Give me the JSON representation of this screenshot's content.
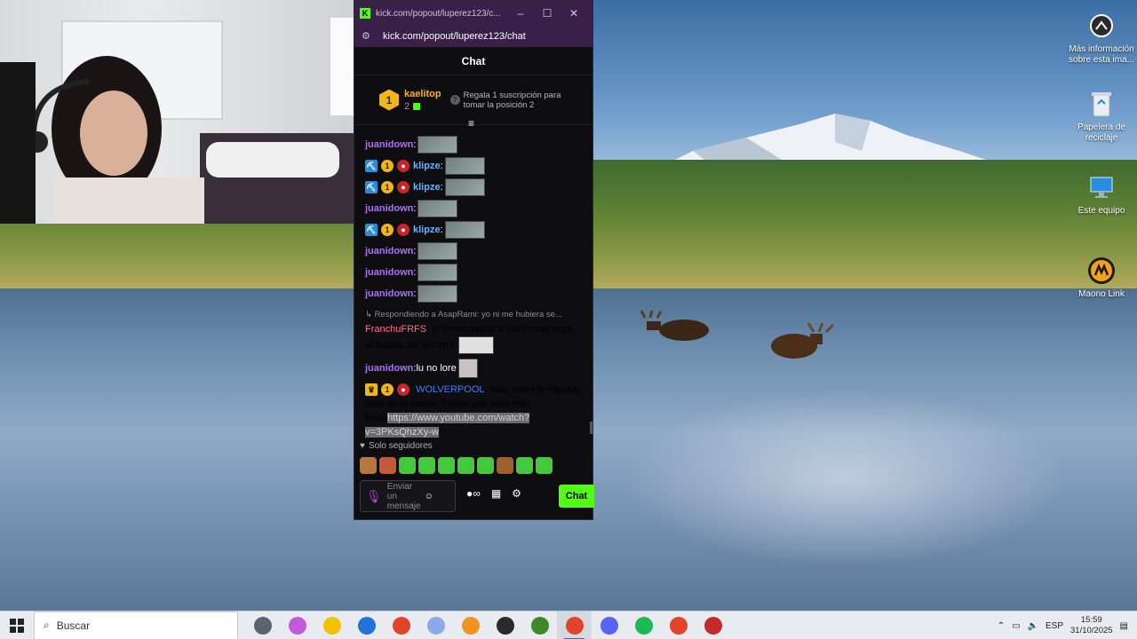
{
  "desktop": {
    "icons": [
      {
        "label": "Más información sobre esta ima...",
        "icon": "camera-info-icon"
      },
      {
        "label": "Papelera de reciclaje",
        "icon": "recycle-bin-icon"
      },
      {
        "label": "Este equipo",
        "icon": "monitor-icon"
      },
      {
        "label": "Maono Link",
        "icon": "maono-link-icon"
      }
    ]
  },
  "browser": {
    "title": "kick.com/popout/luperez123/c...",
    "url": "kick.com/popout/luperez123/chat",
    "controls": {
      "minimize": "–",
      "maximize": "☐",
      "close": "✕"
    }
  },
  "chat": {
    "header": "Chat",
    "leaderboard": {
      "rank": "1",
      "user": "kaelitop",
      "count": "2",
      "hint": "Regala 1 suscripción para tomar la posición 2",
      "hint_icon": "?"
    },
    "filter_icon": "≡",
    "messages": [
      {
        "user": "juanidown",
        "color": "#a970ff",
        "text": "",
        "badges": [],
        "emote": true
      },
      {
        "user": "klipze",
        "color": "#6fb2ff",
        "text": "",
        "badges": [
          "pick",
          "one",
          "red"
        ],
        "emote": true
      },
      {
        "user": "klipze",
        "color": "#6fb2ff",
        "text": "",
        "badges": [
          "pick",
          "one",
          "red"
        ],
        "emote": true
      },
      {
        "user": "juanidown",
        "color": "#a970ff",
        "text": "",
        "badges": [],
        "emote": true
      },
      {
        "user": "klipze",
        "color": "#6fb2ff",
        "text": "",
        "badges": [
          "pick",
          "one",
          "red"
        ],
        "emote": true
      },
      {
        "user": "juanidown",
        "color": "#a970ff",
        "text": "",
        "badges": [],
        "emote": true
      },
      {
        "user": "juanidown",
        "color": "#a970ff",
        "text": "",
        "badges": [],
        "emote": true
      },
      {
        "user": "juanidown",
        "color": "#a970ff",
        "text": "",
        "badges": [],
        "emote": true
      }
    ],
    "reply_to": "Respondiendo a AsapRami: yo ni me hubiera se...",
    "franchu": {
      "user": "FranchuFRFS",
      "color": "#ff6b8a",
      "text": "le tenes miedo a los fisuras niga, te hacias pis encima"
    },
    "juani_last": {
      "user": "juanidown",
      "color": "#a970ff",
      "text": "lu no lore"
    },
    "wolver": {
      "user": "WOLVERPOOL",
      "color": "#3c7dff",
      "text": "este video te explica todo de la noche 7 para que veas mas tarde",
      "link": "https://www.youtube.com/watch?v=3PKsQhzXy-w"
    },
    "followers_only": "Solo seguidores",
    "emote_colors": [
      "#b8773a",
      "#c45a3a",
      "#43c93b",
      "#43c93b",
      "#43c93b",
      "#43c93b",
      "#43c93b",
      "#a0602a",
      "#43c93b",
      "#43c93b"
    ],
    "input": {
      "placeholder": "Enviar un mensaje"
    },
    "send_label": "Chat"
  },
  "taskbar": {
    "search_placeholder": "Buscar",
    "apps": [
      {
        "name": "task-view",
        "color": "#5a6470"
      },
      {
        "name": "copilot",
        "color": "#c25bd8"
      },
      {
        "name": "file-explorer",
        "color": "#f2c200"
      },
      {
        "name": "store",
        "color": "#2273d8"
      },
      {
        "name": "chrome",
        "color": "#e2432a"
      },
      {
        "name": "word",
        "color": "#8fa8e8"
      },
      {
        "name": "sun-app",
        "color": "#f09224"
      },
      {
        "name": "obs",
        "color": "#2a2a2a"
      },
      {
        "name": "minecraft",
        "color": "#3e8a2a"
      },
      {
        "name": "chrome-2",
        "color": "#e2432a"
      },
      {
        "name": "discord",
        "color": "#5865f2"
      },
      {
        "name": "spotify",
        "color": "#1db954"
      },
      {
        "name": "chrome-3",
        "color": "#e2432a"
      },
      {
        "name": "app-red",
        "color": "#c22a2a"
      }
    ],
    "active_index": 9,
    "language": "ESP",
    "time": "15:59",
    "date": "31/10/2025"
  }
}
